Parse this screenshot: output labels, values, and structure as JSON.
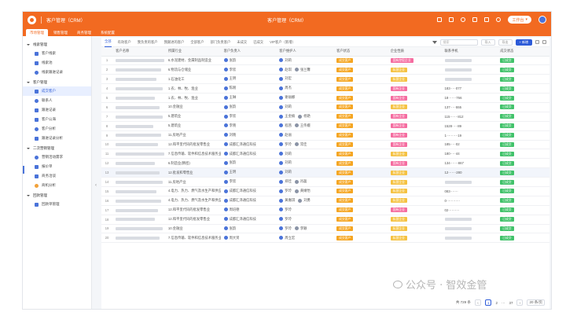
{
  "titlebar": {
    "app_name": "客户管理（CRM）",
    "window_title": "客户管理（CRM）",
    "workbench_label": "工作台"
  },
  "tabs": [
    "市场管理",
    "销售管理",
    "商务管理",
    "系统配置"
  ],
  "sidebar": [
    {
      "type": "group",
      "label": "线索管理"
    },
    {
      "type": "item",
      "label": "客户线索",
      "icon": "users-icon"
    },
    {
      "type": "item",
      "label": "线索池",
      "icon": "share-icon"
    },
    {
      "type": "item",
      "label": "线索跟进记录",
      "icon": "list-icon"
    },
    {
      "type": "group",
      "label": "客户管理"
    },
    {
      "type": "item",
      "label": "成交客户",
      "icon": "grid-icon",
      "active": true
    },
    {
      "type": "item",
      "label": "联系人",
      "icon": "contact-icon"
    },
    {
      "type": "item",
      "label": "跟进记录",
      "icon": "record-icon"
    },
    {
      "type": "item",
      "label": "客户公海",
      "icon": "pool-icon"
    },
    {
      "type": "item",
      "label": "客户分析",
      "icon": "chart-icon"
    },
    {
      "type": "item",
      "label": "跟进记录分析",
      "icon": "analysis-icon"
    },
    {
      "type": "group",
      "label": "二次营销管理"
    },
    {
      "type": "item",
      "label": "营销活动需求",
      "icon": "dollar-icon"
    },
    {
      "type": "item",
      "label": "报价单",
      "icon": "quote-icon"
    },
    {
      "type": "item",
      "label": "商务洽谈",
      "icon": "talk-icon"
    },
    {
      "type": "item",
      "label": "商机分析",
      "icon": "opportunity-icon"
    },
    {
      "type": "group",
      "label": "回款管理"
    },
    {
      "type": "item",
      "label": "回款单管理",
      "icon": "payment-icon"
    }
  ],
  "filter_tabs": [
    "全部",
    "有效客户",
    "我负责的客户",
    "我跟进的客户",
    "全部客户",
    "部门负责客户",
    "未成交",
    "已成交",
    "VIP客户（新增）"
  ],
  "toolbar": {
    "search_placeholder": "搜索",
    "import_label": "导入",
    "export_label": "导出",
    "add_label": "+ 新增"
  },
  "columns": [
    "客户名称",
    "所属行业",
    "客户负责人",
    "客户维护人",
    "客户状态",
    "企业性质",
    "联系手机",
    "成交状态"
  ],
  "rows": [
    {
      "idx": "1",
      "industry": "6.水泥建材、金属制品制造业",
      "owner": [
        "张韵"
      ],
      "maint": [
        "刘莉"
      ],
      "status": "成交客户",
      "nature": "国有控股企业",
      "nature_color": "#f56ca0",
      "phone": "",
      "deal": "已成交"
    },
    {
      "idx": "2",
      "industry": "6.物流与仓储业",
      "owner": [
        "李欣"
      ],
      "maint": [
        "赵琪",
        "张兰馨"
      ],
      "status": "成交客户",
      "nature": "私营企业",
      "nature_color": "#f5c242",
      "phone": "",
      "deal": "已成交"
    },
    {
      "idx": "3",
      "industry": "1.石油化工",
      "owner": [
        "王明"
      ],
      "maint": [
        "刘宏"
      ],
      "status": "成交客户",
      "nature": "私营企业",
      "nature_color": "#f5c242",
      "phone": "",
      "deal": "已成交"
    },
    {
      "idx": "4",
      "industry": "1.农、林、牧、渔业",
      "owner": [
        "陈刚"
      ],
      "maint": [
        "周杰"
      ],
      "status": "成交客户",
      "nature": "国有企业",
      "nature_color": "#f56ca0",
      "phone": "183·····077",
      "deal": "已成交"
    },
    {
      "idx": "5",
      "industry": "1.农、林、牧、渔业",
      "owner": [
        "王琳"
      ],
      "maint": [
        "谢丽娜"
      ],
      "status": "成交客户",
      "nature": "国有企业",
      "nature_color": "#f56ca0",
      "phone": "18·······766",
      "deal": "已成交"
    },
    {
      "idx": "6",
      "industry": "10.金融业",
      "owner": [
        "张韵"
      ],
      "maint": [
        "刘莉"
      ],
      "status": "成交客户",
      "nature": "私营企业",
      "nature_color": "#f5c242",
      "phone": "137·····555",
      "deal": "已成交"
    },
    {
      "idx": "7",
      "industry": "5.建筑业",
      "owner": [
        "李欣"
      ],
      "maint": [
        "王金楠",
        "杨艳"
      ],
      "status": "成交客户",
      "nature": "国有企业",
      "nature_color": "#f56ca0",
      "phone": "115·······812",
      "deal": "已成交"
    },
    {
      "idx": "8",
      "industry": "5.建筑业",
      "owner": [
        "李晓"
      ],
      "maint": [
        "程茜",
        "王伟娥"
      ],
      "status": "成交客户",
      "nature": "国有企业",
      "nature_color": "#f56ca0",
      "phone": "1528·····89",
      "deal": "已成交"
    },
    {
      "idx": "9",
      "industry": "11.房地产业",
      "owner": [
        "刘晓"
      ],
      "maint": [
        "赵丽"
      ],
      "status": "成交客户",
      "nature": "国有企业",
      "nature_color": "#f56ca0",
      "phone": "1··········19",
      "deal": "已成交"
    },
    {
      "idx": "10",
      "industry": "12.和平里代码的批发零售业",
      "owner": [
        "成都汇泽通信科技"
      ],
      "maint": [
        "罗玲",
        "常佳"
      ],
      "status": "成交客户",
      "nature": "国有企业",
      "nature_color": "#f56ca0",
      "phone": "185·····02",
      "deal": "已成交"
    },
    {
      "idx": "11",
      "industry": "7.信息传输、软件和信息技术服务业",
      "owner": [
        "成都汇泽通信科技"
      ],
      "maint": [
        "刘莉"
      ],
      "status": "成交客户",
      "nature": "私营企业",
      "nature_color": "#f5c242",
      "phone": "180·····44",
      "deal": "已成交"
    },
    {
      "idx": "12",
      "industry": "6.制造业(精密)",
      "owner": [
        "张韵"
      ],
      "maint": [
        "刘莉"
      ],
      "status": "成交客户",
      "nature": "国有企业",
      "nature_color": "#f56ca0",
      "phone": "134·······867",
      "deal": "已成交"
    },
    {
      "idx": "13",
      "industry": "12.批发和零售业",
      "owner": [
        "王明"
      ],
      "maint": [
        "刘莉"
      ],
      "status": "成交客户",
      "nature": "私营企业",
      "nature_color": "#f5c242",
      "phone": "12·······280",
      "deal": "已成交",
      "hl": true
    },
    {
      "idx": "14",
      "industry": "11.房地产业",
      "owner": [
        "李欣"
      ],
      "maint": [
        "郑佳",
        "肖磊"
      ],
      "status": "成交客户",
      "nature": "私营企业",
      "nature_color": "#f5c242",
      "phone": "",
      "deal": "已成交"
    },
    {
      "idx": "15",
      "industry": "4.电力、热力、燃气及水生产和供应业",
      "owner": [
        "成都汇泽通信科技"
      ],
      "maint": [
        "罗玲",
        "黄婧怡"
      ],
      "status": "成交客户",
      "nature": "私营企业",
      "nature_color": "#f5c242",
      "phone": "083·······",
      "deal": "已成交"
    },
    {
      "idx": "16",
      "industry": "4.电力、热力、燃气及水生产和供应业",
      "owner": [
        "成都汇泽通信科技"
      ],
      "maint": [
        "黄嘉琪",
        "刘勇"
      ],
      "status": "成交客户",
      "nature": "私营企业",
      "nature_color": "#f5c242",
      "phone": "0············",
      "deal": "已成交"
    },
    {
      "idx": "17",
      "industry": "12.和平里代码的批发零售业",
      "owner": [
        "周培德"
      ],
      "maint": [
        "罗玲"
      ],
      "status": "成交客户",
      "nature": "国有企业",
      "nature_color": "#f56ca0",
      "phone": "02··········",
      "deal": "已成交"
    },
    {
      "idx": "18",
      "industry": "12.和平里代码的批发零售业",
      "owner": [
        "成都汇泽通信科技"
      ],
      "maint": [
        "罗玲"
      ],
      "status": "成交客户",
      "nature": "私营企业",
      "nature_color": "#f5c242",
      "phone": "",
      "deal": "已成交"
    },
    {
      "idx": "19",
      "industry": "10.金融业",
      "owner": [
        "张韵"
      ],
      "maint": [
        "罗玲",
        "李颖"
      ],
      "status": "成交客户",
      "nature": "私营企业",
      "nature_color": "#f5c242",
      "phone": "",
      "deal": "已成交"
    },
    {
      "idx": "20",
      "industry": "7.信息传输、软件和信息技术服务业",
      "owner": [
        "周大贤"
      ],
      "maint": [
        "周立宏"
      ],
      "status": "成交客户",
      "nature": "私营企业",
      "nature_color": "#f5c242",
      "phone": "",
      "deal": "已成交"
    }
  ],
  "pager": {
    "total": "共 729 条",
    "prev": "‹",
    "page1": "1",
    "page2": "2",
    "dots": "···",
    "last": "37",
    "next": "›",
    "size": "20 条/页"
  },
  "watermark": "公众号 · 智效金管"
}
